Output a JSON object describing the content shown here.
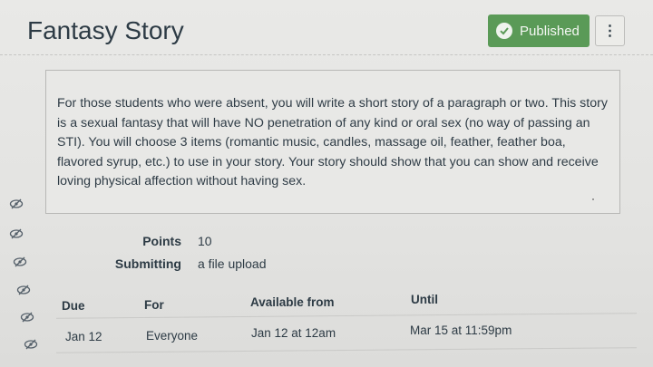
{
  "header": {
    "title": "Fantasy Story",
    "status_label": "Published",
    "more_label": "⋮"
  },
  "description": "For those students who were absent, you will write a short story of a paragraph or two. This story is a sexual fantasy that will have NO penetration of any kind or oral sex (no way of passing an STI). You will choose 3 items (romantic music, candles, massage oil, feather, feather boa, flavored syrup, etc.) to use in your story. Your story should show that you can show and receive loving physical affection without having sex.",
  "details": {
    "points_label": "Points",
    "points_value": "10",
    "submitting_label": "Submitting",
    "submitting_value": "a file upload"
  },
  "dates_table": {
    "headers": [
      "Due",
      "For",
      "Available from",
      "Until"
    ],
    "rows": [
      [
        "Jan 12",
        "Everyone",
        "Jan 12 at 12am",
        "Mar 15 at 11:59pm"
      ]
    ]
  },
  "colors": {
    "published_green": "#5a9a57",
    "text": "#2d3b45"
  },
  "icons": [
    "check-circle-icon",
    "kebab-menu-icon",
    "eye-slash-icon"
  ]
}
